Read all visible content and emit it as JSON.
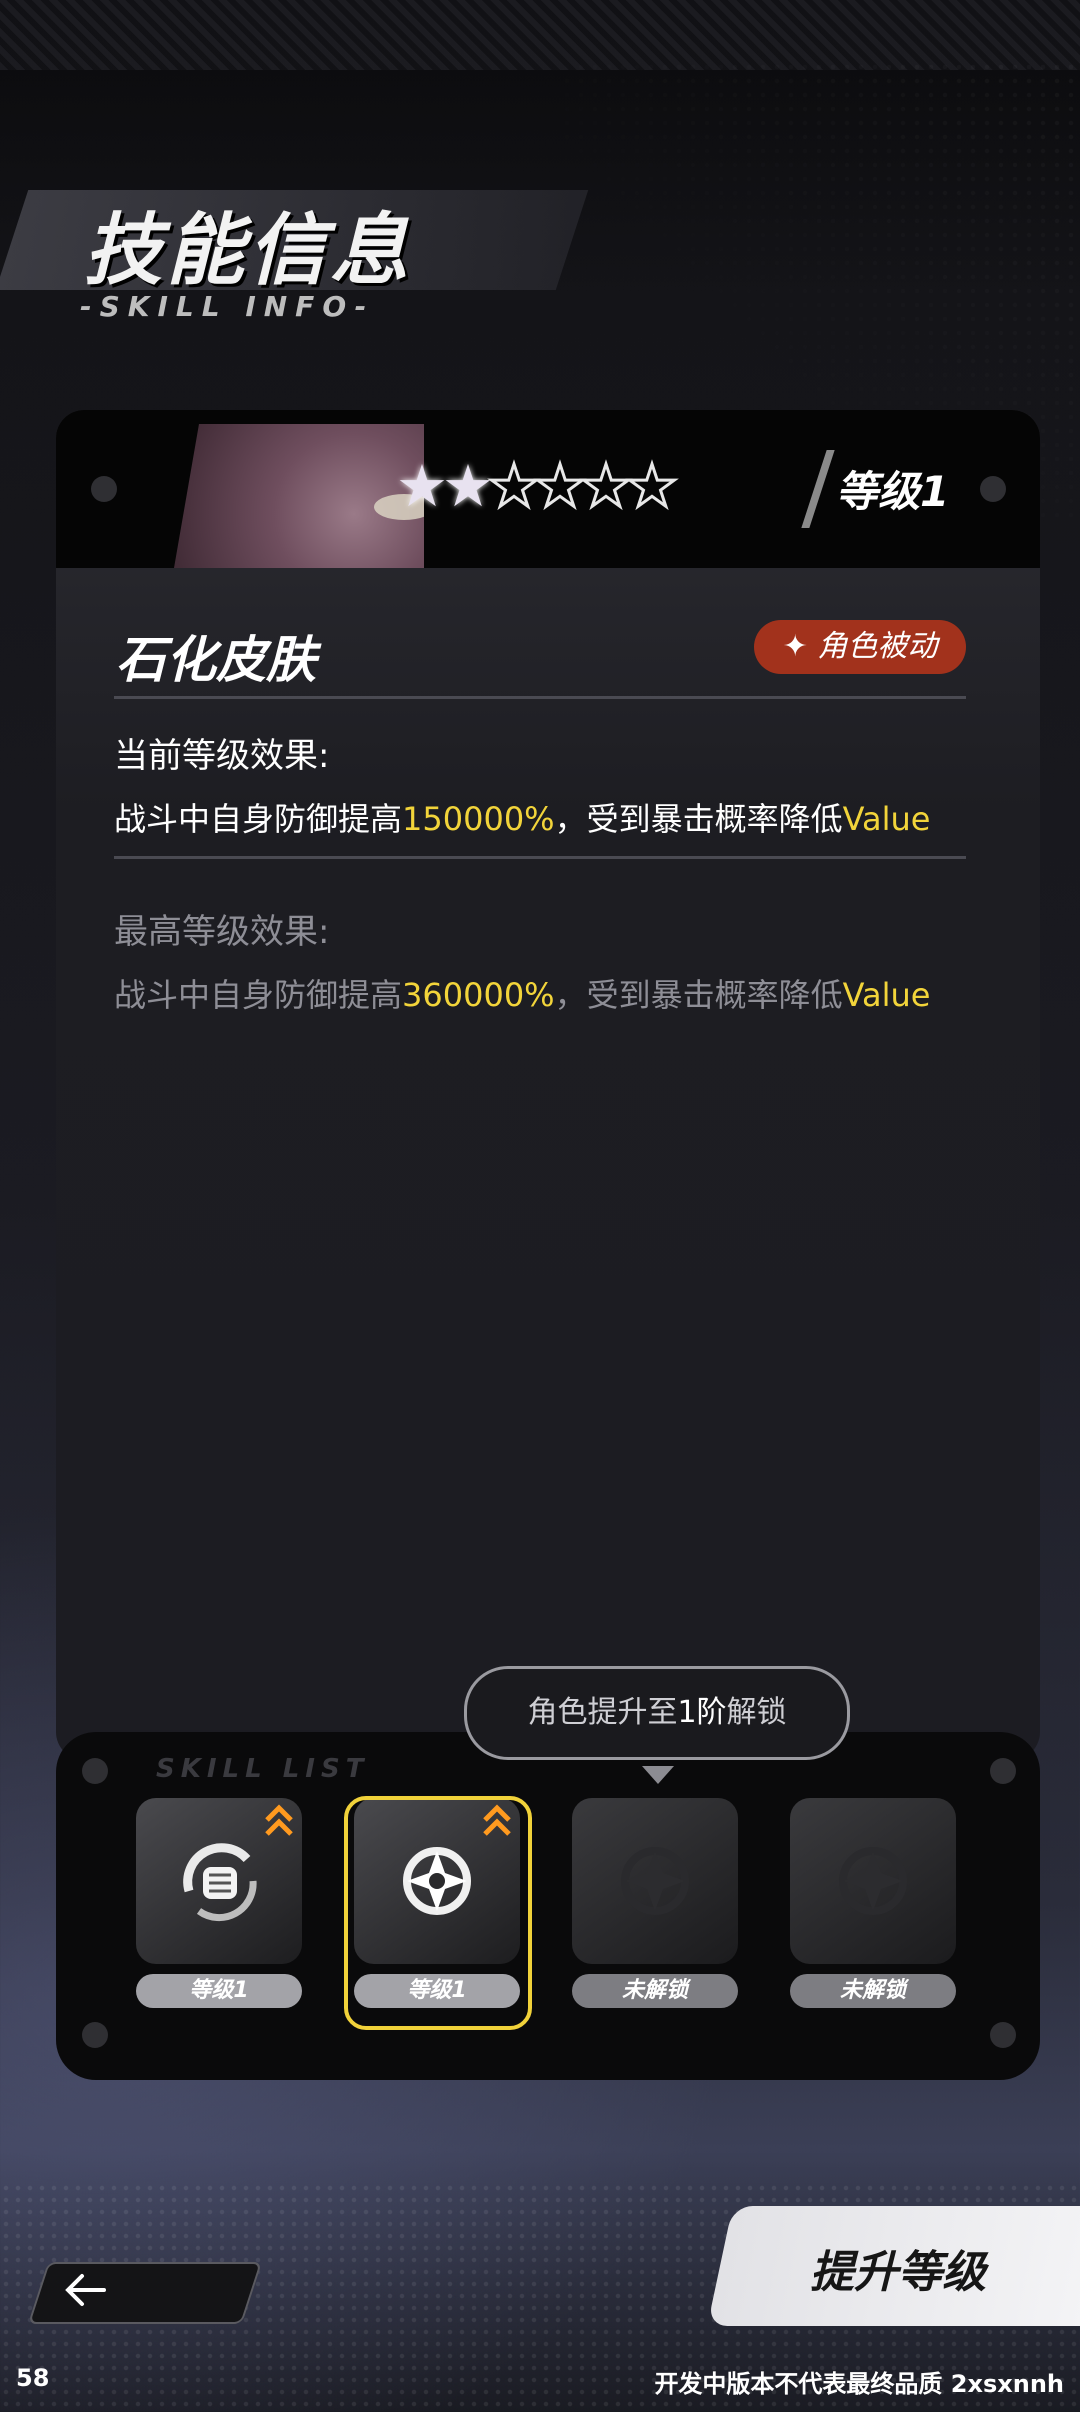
{
  "header": {
    "title": "技能信息",
    "subtitle": "-SKILL INFO-"
  },
  "card": {
    "stars_filled": 2,
    "stars_total": 6,
    "level_label": "等级1",
    "skill_name": "石化皮肤",
    "badge_label": "角色被动",
    "current": {
      "title": "当前等级效果:",
      "text_before": "战斗中自身防御提高",
      "value1": "150000%",
      "text_mid": "，受到暴击概率降低",
      "value2": "Value"
    },
    "max": {
      "title": "最高等级效果:",
      "text_before": "战斗中自身防御提高",
      "value1": "360000%",
      "text_mid": "，受到暴击概率降低",
      "value2": "Value"
    }
  },
  "tooltip": {
    "before": "角色提升至",
    "highlight": "1阶",
    "after": "解锁"
  },
  "skill_list": {
    "label": "SKILL LIST",
    "slots": [
      {
        "caption": "等级1",
        "icon": "fist-icon",
        "upgradable": true
      },
      {
        "caption": "等级1",
        "icon": "shuriken-icon",
        "upgradable": true,
        "selected": true
      },
      {
        "caption": "未解锁",
        "icon": "shuriken-icon-locked",
        "upgradable": false
      },
      {
        "caption": "未解锁",
        "icon": "shuriken-icon-locked",
        "upgradable": false
      }
    ]
  },
  "actions": {
    "back_icon": "arrow-left-icon",
    "upgrade_label": "提升等级"
  },
  "footer": {
    "left": "58",
    "right": "开发中版本不代表最终品质 2xsxnnh"
  },
  "colors": {
    "accent_yellow": "#f2d43a",
    "badge_red": "#a2321c",
    "selection": "#f1d23a"
  }
}
